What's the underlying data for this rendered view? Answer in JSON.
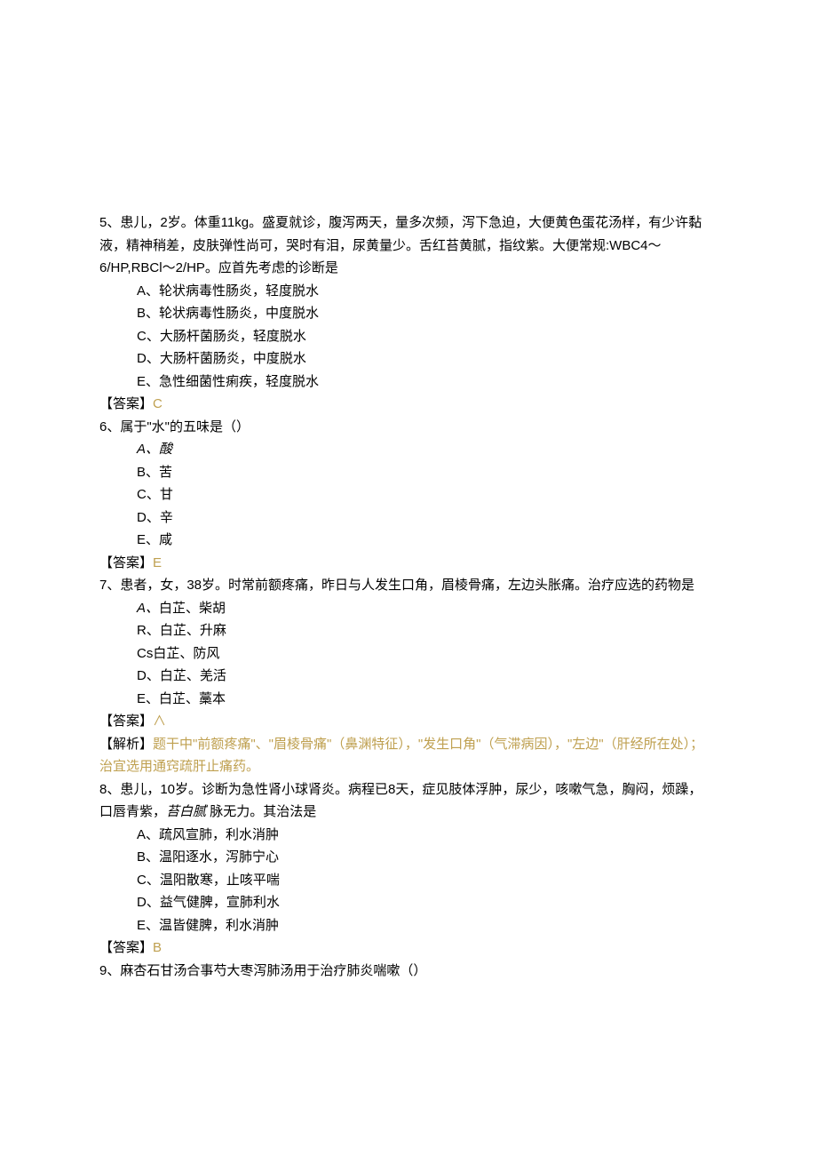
{
  "questions": [
    {
      "num": "5",
      "stem_lines": [
        "5、患儿，2岁。体重11kg。盛夏就诊，腹泻两天，量多次频，泻下急迫，大便黄色蛋花汤样，有少许黏液，精神稍差，皮肤弹性尚可，哭时有泪，尿黄量少。舌红苔黄腻，指纹紫。大便常规:WBC4～6/HP,RBCl～2/HP。应首先考虑的诊断是"
      ],
      "options": [
        "A、轮状病毒性肠炎，轻度脱水",
        "B、轮状病毒性肠炎，中度脱水",
        "C、大肠杆菌肠炎，轻度脱水",
        "D、大肠杆菌肠炎，中度脱水",
        "E、急性细菌性痢疾，轻度脱水"
      ],
      "answer_label": "【答案】",
      "answer_value": "C"
    },
    {
      "num": "6",
      "stem_lines": [
        "6、属于\"水\"的五味是（）"
      ],
      "options_special_first": {
        "text": "A、酸",
        "italic": true
      },
      "options": [
        "B、苦",
        "C、甘",
        "D、辛",
        "E、咸"
      ],
      "answer_label": "【答案】",
      "answer_value": "E"
    },
    {
      "num": "7",
      "stem_lines": [
        "7、患者，女，38岁。时常前额疼痛，昨日与人发生口角，眉棱骨痛，左边头胀痛。治疗应选的药物是"
      ],
      "options_special_first": {
        "text": "A、白芷、柴胡",
        "italic_prefix": "A、",
        "rest": "白芷、柴胡"
      },
      "options": [
        "R、白芷、升麻",
        "Cs白芷、防风",
        "D、白芷、羌活",
        "E、白芷、藁本"
      ],
      "answer_label": "【答案】",
      "answer_value": "∧",
      "explain_label": "【解析】",
      "explain_value": "题干中\"前额疼痛\"、\"眉棱骨痛\"（鼻渊特征），\"发生口角\"（气滞病因），\"左边\"（肝经所在处）；治宜选用通窍疏肝止痛药。"
    },
    {
      "num": "8",
      "stem_pre": "8、患儿，10岁。诊断为急性肾小球肾炎。病程已8天，症见肢体浮肿，尿少，咳嗽气急，胸闷，烦躁，口唇青紫，",
      "stem_italic": "苔白腻",
      "stem_post": " 脉无力。其治法是",
      "options": [
        "A、疏风宣肺，利水消肿",
        "B、温阳逐水，泻肺宁心",
        "C、温阳散寒，止咳平喘",
        "D、益气健脾，宣肺利水",
        "E、温皆健脾，利水消肿"
      ],
      "answer_label": "【答案】",
      "answer_value": "B"
    },
    {
      "num": "9",
      "stem_lines": [
        "9、麻杏石甘汤合事芍大枣泻肺汤用于治疗肺炎喘嗽（）"
      ]
    }
  ]
}
